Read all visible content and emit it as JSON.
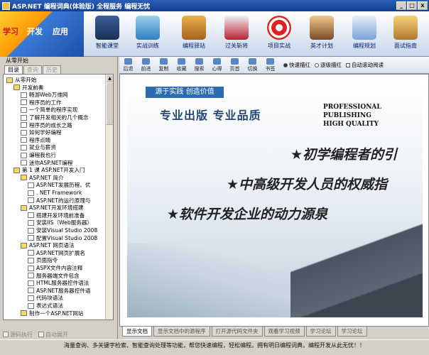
{
  "window": {
    "title": "ASP.NET 编程词典(体验版)   全程服务   编程无忧",
    "min": "_",
    "max": "□",
    "close": "x"
  },
  "logo": {
    "w1": "学习",
    "w2": "开发",
    "w3": "应用"
  },
  "toolbar": [
    {
      "label": "智能课堂"
    },
    {
      "label": "实战训练"
    },
    {
      "label": "编程驿站"
    },
    {
      "label": "过关斩将"
    },
    {
      "label": "项目实战"
    },
    {
      "label": "英才计划"
    },
    {
      "label": "编程规划"
    },
    {
      "label": "面试指南"
    }
  ],
  "leftpanel": {
    "title": "从零开始",
    "tabs": [
      "目录",
      "查询",
      "历史"
    ],
    "bottom": [
      "源码执行",
      "自动展开"
    ]
  },
  "tree": [
    {
      "t": "从零开始",
      "lv": 0,
      "k": "fold"
    },
    {
      "t": "开发前奏",
      "lv": 1,
      "k": "fold"
    },
    {
      "t": "畅游Web万维网",
      "lv": 2,
      "k": "doc"
    },
    {
      "t": "程序员的工作",
      "lv": 2,
      "k": "doc"
    },
    {
      "t": "一个简单的程序实现",
      "lv": 2,
      "k": "doc"
    },
    {
      "t": "了解开发相关的几个概念",
      "lv": 2,
      "k": "doc"
    },
    {
      "t": "程序员的成长之路",
      "lv": 2,
      "k": "doc"
    },
    {
      "t": "如何学好编程",
      "lv": 2,
      "k": "doc"
    },
    {
      "t": "程序点睛",
      "lv": 2,
      "k": "doc"
    },
    {
      "t": "就业与薪资",
      "lv": 2,
      "k": "doc"
    },
    {
      "t": "编程我也行",
      "lv": 2,
      "k": "doc"
    },
    {
      "t": "迷你ASP.NET编程",
      "lv": 2,
      "k": "doc"
    },
    {
      "t": "第 1 课 ASP.NET开发入门",
      "lv": 1,
      "k": "fold"
    },
    {
      "t": "ASP.NET 简介",
      "lv": 2,
      "k": "fold"
    },
    {
      "t": "ASP.NET发展历程、优",
      "lv": 3,
      "k": "doc"
    },
    {
      "t": ". NET Framework",
      "lv": 3,
      "k": "doc"
    },
    {
      "t": "ASP.NET的运行原理与",
      "lv": 3,
      "k": "doc"
    },
    {
      "t": "ASP.NET开发环境搭建",
      "lv": 2,
      "k": "fold"
    },
    {
      "t": "搭建开发环境前准备",
      "lv": 3,
      "k": "doc"
    },
    {
      "t": "安装IIS（Web服务器）",
      "lv": 3,
      "k": "doc"
    },
    {
      "t": "安装Visual Studio 2008",
      "lv": 3,
      "k": "doc"
    },
    {
      "t": "配置Visual Studio 2008",
      "lv": 3,
      "k": "doc"
    },
    {
      "t": "ASP.NET 网页语法",
      "lv": 2,
      "k": "fold"
    },
    {
      "t": "ASP.NET网页扩展名",
      "lv": 3,
      "k": "doc"
    },
    {
      "t": "页面指令",
      "lv": 3,
      "k": "doc"
    },
    {
      "t": "ASPX文件内容注释",
      "lv": 3,
      "k": "doc"
    },
    {
      "t": "服务器端文件包含",
      "lv": 3,
      "k": "doc"
    },
    {
      "t": "HTML服务器控件语法",
      "lv": 3,
      "k": "doc"
    },
    {
      "t": "ASP.NET服务器控件语",
      "lv": 3,
      "k": "doc"
    },
    {
      "t": "代码块语法",
      "lv": 3,
      "k": "doc"
    },
    {
      "t": "表达式语法",
      "lv": 3,
      "k": "doc"
    },
    {
      "t": "制作一个ASP.NET网站",
      "lv": 2,
      "k": "fold"
    }
  ],
  "navbar": {
    "buttons": [
      "后退",
      "前进",
      "复制",
      "收藏",
      "搜索",
      "心得",
      "页首",
      "切换",
      "书签"
    ],
    "options": [
      "快速描红",
      "逐级描红",
      "自动滚动阅读"
    ]
  },
  "banner": {
    "tag": "源于实践   创造价值",
    "slogan": "专业出版   专业品质",
    "pq1": "PROFESSIONAL PUBLISHING",
    "pq2": "HIGH QUALITY",
    "line1": "★初学编程者的引",
    "line2": "★中高级开发人员的权威指",
    "line3": "★软件开发企业的动力源泉"
  },
  "tabs": [
    "显示文档",
    "显示文档中的源程序",
    "打开源代码文件夹",
    "观看学习视频",
    "学习论坛",
    "学习论坛"
  ],
  "status": "海量查询、多关键字检索、智能查询处理等功能，帮您快速编程，轻松编程。拥有明日编程词典，编程开发从此无忧！！",
  "colors": {
    "titlebar": "#1f4fa3",
    "accent": "#2c6bb0",
    "logo_red": "#d8141a"
  }
}
